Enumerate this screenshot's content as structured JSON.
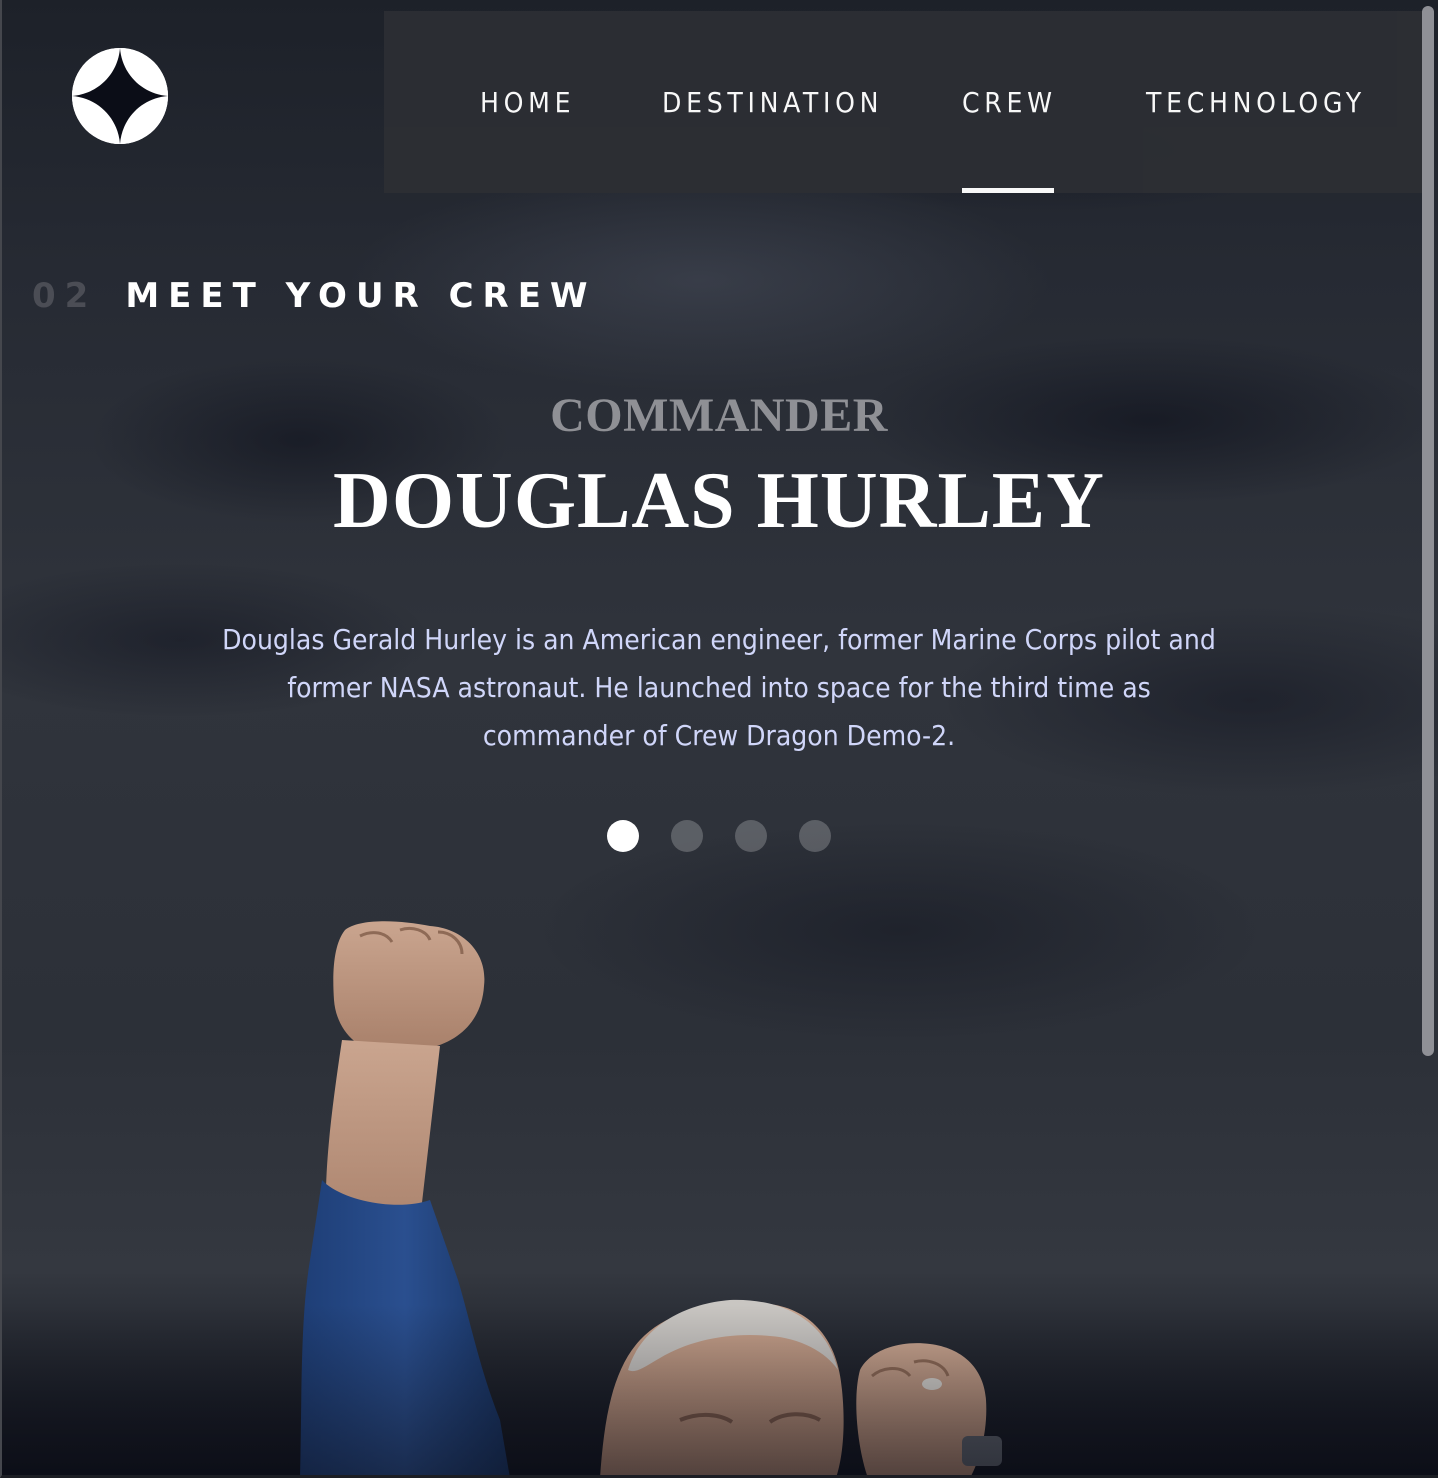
{
  "header": {
    "logo_icon": "star-logo-icon",
    "nav": [
      {
        "label": "HOME",
        "active": false
      },
      {
        "label": "DESTINATION",
        "active": false
      },
      {
        "label": "CREW",
        "active": true
      },
      {
        "label": "TECHNOLOGY",
        "active": false
      }
    ]
  },
  "section": {
    "number": "02",
    "title": "MEET YOUR CREW"
  },
  "crew": {
    "role": "COMMANDER",
    "name": "DOUGLAS HURLEY",
    "bio": "Douglas Gerald Hurley is an American engineer, former Marine Corps pilot and former NASA astronaut. He launched into space for the third time as commander of Crew Dragon Demo-2.",
    "slides": [
      {
        "active": true
      },
      {
        "active": false
      },
      {
        "active": false
      },
      {
        "active": false
      }
    ]
  },
  "colors": {
    "background": "#0b0d17",
    "bio_text": "#d0d6f9",
    "role_text": "#8f9095",
    "heading_number": "#4b4d55",
    "nav_background": "#2c2e34"
  }
}
